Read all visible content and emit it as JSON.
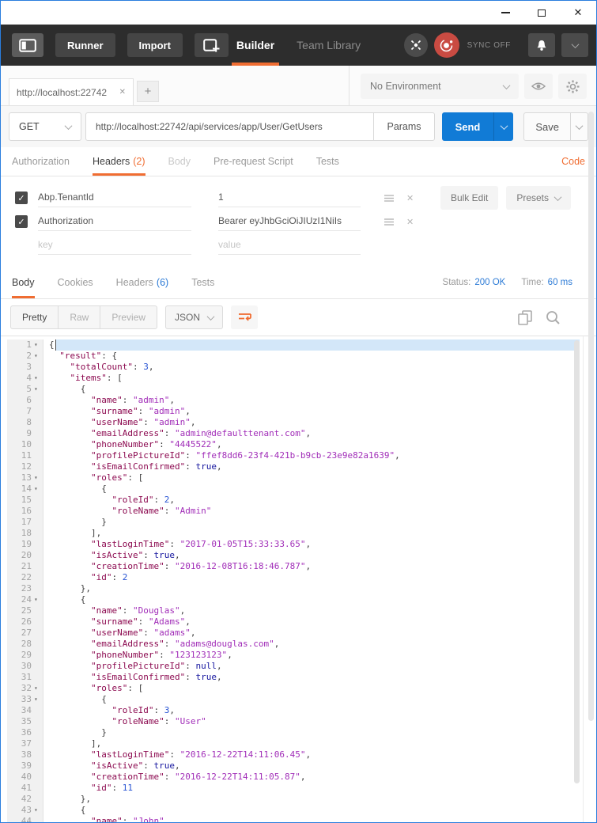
{
  "toolbar": {
    "runner_label": "Runner",
    "import_label": "Import",
    "builder_tab": "Builder",
    "team_library_tab": "Team Library",
    "sync_label": "SYNC OFF"
  },
  "tabstrip": {
    "request_tab_title": "http://localhost:22742",
    "close_glyph": "✕",
    "new_tab_label": "+",
    "environment_selector": "No Environment"
  },
  "request": {
    "method": "GET",
    "url": "http://localhost:22742/api/services/app/User/GetUsers",
    "params_label": "Params",
    "send_label": "Send",
    "save_label": "Save"
  },
  "request_tabs": {
    "authorization": "Authorization",
    "headers": "Headers",
    "headers_count": "(2)",
    "body": "Body",
    "prerequest": "Pre-request Script",
    "tests": "Tests",
    "code_link": "Code"
  },
  "headers_editor": {
    "check_glyph": "✓",
    "rows": [
      {
        "key": "Abp.TenantId",
        "value": "1"
      },
      {
        "key": "Authorization",
        "value": "Bearer eyJhbGciOiJIUzI1NiIs"
      }
    ],
    "key_placeholder": "key",
    "value_placeholder": "value",
    "bulk_edit_label": "Bulk Edit",
    "presets_label": "Presets"
  },
  "response": {
    "body_tab": "Body",
    "cookies_tab": "Cookies",
    "headers_tab": "Headers",
    "headers_count": "(6)",
    "tests_tab": "Tests",
    "status_label": "Status:",
    "status_value": "200 OK",
    "time_label": "Time:",
    "time_value": "60 ms",
    "pretty": "Pretty",
    "raw": "Raw",
    "preview": "Preview",
    "format": "JSON"
  },
  "colors": {
    "accent_orange": "#f06d32",
    "send_blue": "#117bd6",
    "status_blue": "#2d7bd6",
    "sync_red": "#c94b42"
  },
  "code": {
    "lines": [
      {
        "fold": true,
        "cursor": true,
        "tokens": [
          [
            "p",
            "{"
          ]
        ]
      },
      {
        "fold": true,
        "tokens": [
          [
            "p",
            "  "
          ],
          [
            "k",
            "\"result\""
          ],
          [
            "p",
            ": {"
          ]
        ]
      },
      {
        "tokens": [
          [
            "p",
            "    "
          ],
          [
            "k",
            "\"totalCount\""
          ],
          [
            "p",
            ": "
          ],
          [
            "n",
            "3"
          ],
          [
            "p",
            ","
          ]
        ]
      },
      {
        "fold": true,
        "tokens": [
          [
            "p",
            "    "
          ],
          [
            "k",
            "\"items\""
          ],
          [
            "p",
            ": ["
          ]
        ]
      },
      {
        "fold": true,
        "tokens": [
          [
            "p",
            "      {"
          ]
        ]
      },
      {
        "tokens": [
          [
            "p",
            "        "
          ],
          [
            "k",
            "\"name\""
          ],
          [
            "p",
            ": "
          ],
          [
            "s",
            "\"admin\""
          ],
          [
            "p",
            ","
          ]
        ]
      },
      {
        "tokens": [
          [
            "p",
            "        "
          ],
          [
            "k",
            "\"surname\""
          ],
          [
            "p",
            ": "
          ],
          [
            "s",
            "\"admin\""
          ],
          [
            "p",
            ","
          ]
        ]
      },
      {
        "tokens": [
          [
            "p",
            "        "
          ],
          [
            "k",
            "\"userName\""
          ],
          [
            "p",
            ": "
          ],
          [
            "s",
            "\"admin\""
          ],
          [
            "p",
            ","
          ]
        ]
      },
      {
        "tokens": [
          [
            "p",
            "        "
          ],
          [
            "k",
            "\"emailAddress\""
          ],
          [
            "p",
            ": "
          ],
          [
            "s",
            "\"admin@defaulttenant.com\""
          ],
          [
            "p",
            ","
          ]
        ]
      },
      {
        "tokens": [
          [
            "p",
            "        "
          ],
          [
            "k",
            "\"phoneNumber\""
          ],
          [
            "p",
            ": "
          ],
          [
            "s",
            "\"4445522\""
          ],
          [
            "p",
            ","
          ]
        ]
      },
      {
        "tokens": [
          [
            "p",
            "        "
          ],
          [
            "k",
            "\"profilePictureId\""
          ],
          [
            "p",
            ": "
          ],
          [
            "s",
            "\"ffef8dd6-23f4-421b-b9cb-23e9e82a1639\""
          ],
          [
            "p",
            ","
          ]
        ]
      },
      {
        "tokens": [
          [
            "p",
            "        "
          ],
          [
            "k",
            "\"isEmailConfirmed\""
          ],
          [
            "p",
            ": "
          ],
          [
            "b",
            "true"
          ],
          [
            "p",
            ","
          ]
        ]
      },
      {
        "fold": true,
        "tokens": [
          [
            "p",
            "        "
          ],
          [
            "k",
            "\"roles\""
          ],
          [
            "p",
            ": ["
          ]
        ]
      },
      {
        "fold": true,
        "tokens": [
          [
            "p",
            "          {"
          ]
        ]
      },
      {
        "tokens": [
          [
            "p",
            "            "
          ],
          [
            "k",
            "\"roleId\""
          ],
          [
            "p",
            ": "
          ],
          [
            "n",
            "2"
          ],
          [
            "p",
            ","
          ]
        ]
      },
      {
        "tokens": [
          [
            "p",
            "            "
          ],
          [
            "k",
            "\"roleName\""
          ],
          [
            "p",
            ": "
          ],
          [
            "s",
            "\"Admin\""
          ]
        ]
      },
      {
        "tokens": [
          [
            "p",
            "          }"
          ]
        ]
      },
      {
        "tokens": [
          [
            "p",
            "        ],"
          ]
        ]
      },
      {
        "tokens": [
          [
            "p",
            "        "
          ],
          [
            "k",
            "\"lastLoginTime\""
          ],
          [
            "p",
            ": "
          ],
          [
            "s",
            "\"2017-01-05T15:33:33.65\""
          ],
          [
            "p",
            ","
          ]
        ]
      },
      {
        "tokens": [
          [
            "p",
            "        "
          ],
          [
            "k",
            "\"isActive\""
          ],
          [
            "p",
            ": "
          ],
          [
            "b",
            "true"
          ],
          [
            "p",
            ","
          ]
        ]
      },
      {
        "tokens": [
          [
            "p",
            "        "
          ],
          [
            "k",
            "\"creationTime\""
          ],
          [
            "p",
            ": "
          ],
          [
            "s",
            "\"2016-12-08T16:18:46.787\""
          ],
          [
            "p",
            ","
          ]
        ]
      },
      {
        "tokens": [
          [
            "p",
            "        "
          ],
          [
            "k",
            "\"id\""
          ],
          [
            "p",
            ": "
          ],
          [
            "n",
            "2"
          ]
        ]
      },
      {
        "tokens": [
          [
            "p",
            "      },"
          ]
        ]
      },
      {
        "fold": true,
        "tokens": [
          [
            "p",
            "      {"
          ]
        ]
      },
      {
        "tokens": [
          [
            "p",
            "        "
          ],
          [
            "k",
            "\"name\""
          ],
          [
            "p",
            ": "
          ],
          [
            "s",
            "\"Douglas\""
          ],
          [
            "p",
            ","
          ]
        ]
      },
      {
        "tokens": [
          [
            "p",
            "        "
          ],
          [
            "k",
            "\"surname\""
          ],
          [
            "p",
            ": "
          ],
          [
            "s",
            "\"Adams\""
          ],
          [
            "p",
            ","
          ]
        ]
      },
      {
        "tokens": [
          [
            "p",
            "        "
          ],
          [
            "k",
            "\"userName\""
          ],
          [
            "p",
            ": "
          ],
          [
            "s",
            "\"adams\""
          ],
          [
            "p",
            ","
          ]
        ]
      },
      {
        "tokens": [
          [
            "p",
            "        "
          ],
          [
            "k",
            "\"emailAddress\""
          ],
          [
            "p",
            ": "
          ],
          [
            "s",
            "\"adams@douglas.com\""
          ],
          [
            "p",
            ","
          ]
        ]
      },
      {
        "tokens": [
          [
            "p",
            "        "
          ],
          [
            "k",
            "\"phoneNumber\""
          ],
          [
            "p",
            ": "
          ],
          [
            "s",
            "\"123123123\""
          ],
          [
            "p",
            ","
          ]
        ]
      },
      {
        "tokens": [
          [
            "p",
            "        "
          ],
          [
            "k",
            "\"profilePictureId\""
          ],
          [
            "p",
            ": "
          ],
          [
            "b",
            "null"
          ],
          [
            "p",
            ","
          ]
        ]
      },
      {
        "tokens": [
          [
            "p",
            "        "
          ],
          [
            "k",
            "\"isEmailConfirmed\""
          ],
          [
            "p",
            ": "
          ],
          [
            "b",
            "true"
          ],
          [
            "p",
            ","
          ]
        ]
      },
      {
        "fold": true,
        "tokens": [
          [
            "p",
            "        "
          ],
          [
            "k",
            "\"roles\""
          ],
          [
            "p",
            ": ["
          ]
        ]
      },
      {
        "fold": true,
        "tokens": [
          [
            "p",
            "          {"
          ]
        ]
      },
      {
        "tokens": [
          [
            "p",
            "            "
          ],
          [
            "k",
            "\"roleId\""
          ],
          [
            "p",
            ": "
          ],
          [
            "n",
            "3"
          ],
          [
            "p",
            ","
          ]
        ]
      },
      {
        "tokens": [
          [
            "p",
            "            "
          ],
          [
            "k",
            "\"roleName\""
          ],
          [
            "p",
            ": "
          ],
          [
            "s",
            "\"User\""
          ]
        ]
      },
      {
        "tokens": [
          [
            "p",
            "          }"
          ]
        ]
      },
      {
        "tokens": [
          [
            "p",
            "        ],"
          ]
        ]
      },
      {
        "tokens": [
          [
            "p",
            "        "
          ],
          [
            "k",
            "\"lastLoginTime\""
          ],
          [
            "p",
            ": "
          ],
          [
            "s",
            "\"2016-12-22T14:11:06.45\""
          ],
          [
            "p",
            ","
          ]
        ]
      },
      {
        "tokens": [
          [
            "p",
            "        "
          ],
          [
            "k",
            "\"isActive\""
          ],
          [
            "p",
            ": "
          ],
          [
            "b",
            "true"
          ],
          [
            "p",
            ","
          ]
        ]
      },
      {
        "tokens": [
          [
            "p",
            "        "
          ],
          [
            "k",
            "\"creationTime\""
          ],
          [
            "p",
            ": "
          ],
          [
            "s",
            "\"2016-12-22T14:11:05.87\""
          ],
          [
            "p",
            ","
          ]
        ]
      },
      {
        "tokens": [
          [
            "p",
            "        "
          ],
          [
            "k",
            "\"id\""
          ],
          [
            "p",
            ": "
          ],
          [
            "n",
            "11"
          ]
        ]
      },
      {
        "tokens": [
          [
            "p",
            "      },"
          ]
        ]
      },
      {
        "fold": true,
        "tokens": [
          [
            "p",
            "      {"
          ]
        ]
      },
      {
        "tokens": [
          [
            "p",
            "        "
          ],
          [
            "k",
            "\"name\""
          ],
          [
            "p",
            ": "
          ],
          [
            "s",
            "\"John\""
          ],
          [
            "p",
            ","
          ]
        ]
      }
    ]
  }
}
